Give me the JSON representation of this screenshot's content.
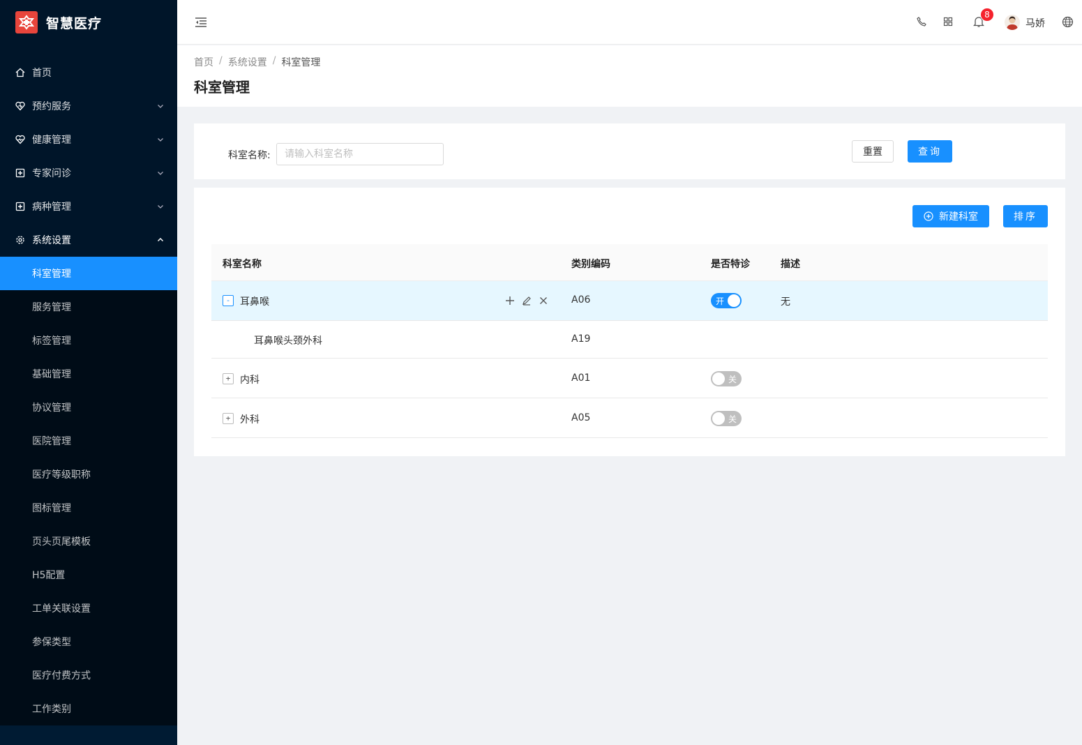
{
  "app": {
    "title": "智慧医疗",
    "brand_color": "#e8453c",
    "accent_color": "#1890ff"
  },
  "sidebar": {
    "items": [
      {
        "label": "首页",
        "icon": "home-icon"
      },
      {
        "label": "预约服务",
        "icon": "heart-icon"
      },
      {
        "label": "健康管理",
        "icon": "heart-pulse-icon"
      },
      {
        "label": "专家问诊",
        "icon": "plus-square-icon"
      },
      {
        "label": "病种管理",
        "icon": "plus-square-icon"
      },
      {
        "label": "系统设置",
        "icon": "gear-icon"
      }
    ],
    "sub_items": [
      "科室管理",
      "服务管理",
      "标签管理",
      "基础管理",
      "协议管理",
      "医院管理",
      "医疗等级职称",
      "图标管理",
      "页头页尾模板",
      "H5配置",
      "工单关联设置",
      "参保类型",
      "医疗付费方式",
      "工作类别"
    ]
  },
  "header": {
    "notification_count": "8",
    "username": "马娇"
  },
  "breadcrumb": [
    "首页",
    "系统设置",
    "科室管理"
  ],
  "page_title": "科室管理",
  "search": {
    "label": "科室名称:",
    "placeholder": "请输入科室名称",
    "value": "",
    "reset_label": "重置",
    "query_label": "查询"
  },
  "toolbar": {
    "new_label": "新建科室",
    "sort_label": "排序"
  },
  "table": {
    "columns": [
      "科室名称",
      "类别编码",
      "是否特诊",
      "描述"
    ],
    "rows": [
      {
        "name": "耳鼻喉",
        "code": "A06",
        "special": "开",
        "desc": "无"
      },
      {
        "name": "耳鼻喉头颈外科",
        "code": "A19",
        "special": "",
        "desc": ""
      },
      {
        "name": "内科",
        "code": "A01",
        "special": "关",
        "desc": ""
      },
      {
        "name": "外科",
        "code": "A05",
        "special": "关",
        "desc": ""
      }
    ]
  }
}
